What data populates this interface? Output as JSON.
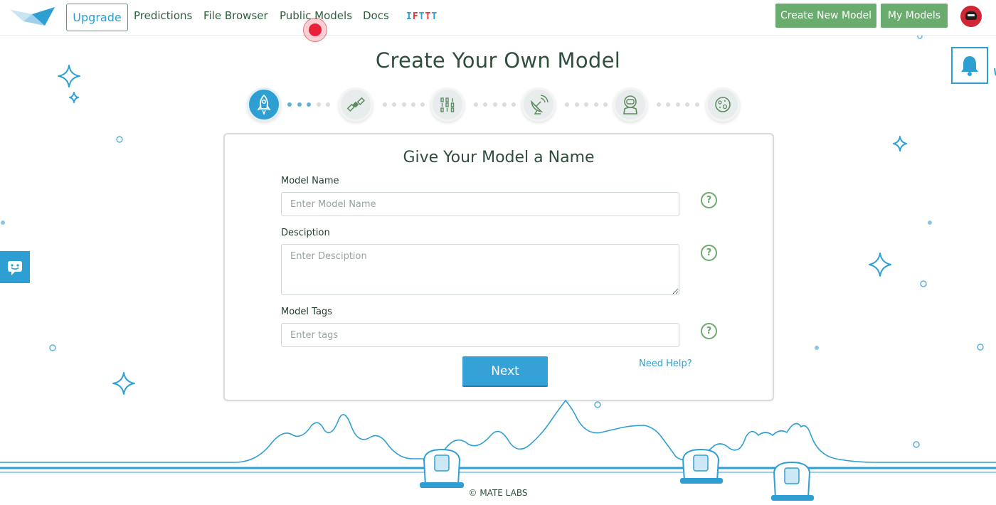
{
  "nav": {
    "upgrade_label": "Upgrade",
    "links": [
      "Predictions",
      "File Browser",
      "Public Models",
      "Docs"
    ],
    "ifttt_letters": [
      "I",
      "F",
      "T",
      "T",
      "T"
    ],
    "create_model_label": "Create New Model",
    "my_models_label": "My Models"
  },
  "page": {
    "title": "Create Your Own Model"
  },
  "stepper": {
    "steps": [
      "rocket-icon",
      "satellite-icon",
      "binary-code-icon",
      "satellite-dish-icon",
      "astronaut-icon",
      "moon-icon"
    ],
    "active_step": 1
  },
  "form": {
    "title": "Give Your Model a Name",
    "model_name_label": "Model Name",
    "model_name_placeholder": "Enter Model Name",
    "description_label": "Desciption",
    "description_placeholder": "Enter Desciption",
    "tags_label": "Model Tags",
    "tags_placeholder": "Enter tags",
    "help_glyph": "?",
    "next_label": "Next",
    "need_help_label": "Need Help?"
  },
  "footer": {
    "copyright": "© MATE LABS"
  },
  "colors": {
    "accent_blue": "#2e9fd3",
    "accent_green": "#6aab6e",
    "title_green": "#2f4f3c"
  }
}
